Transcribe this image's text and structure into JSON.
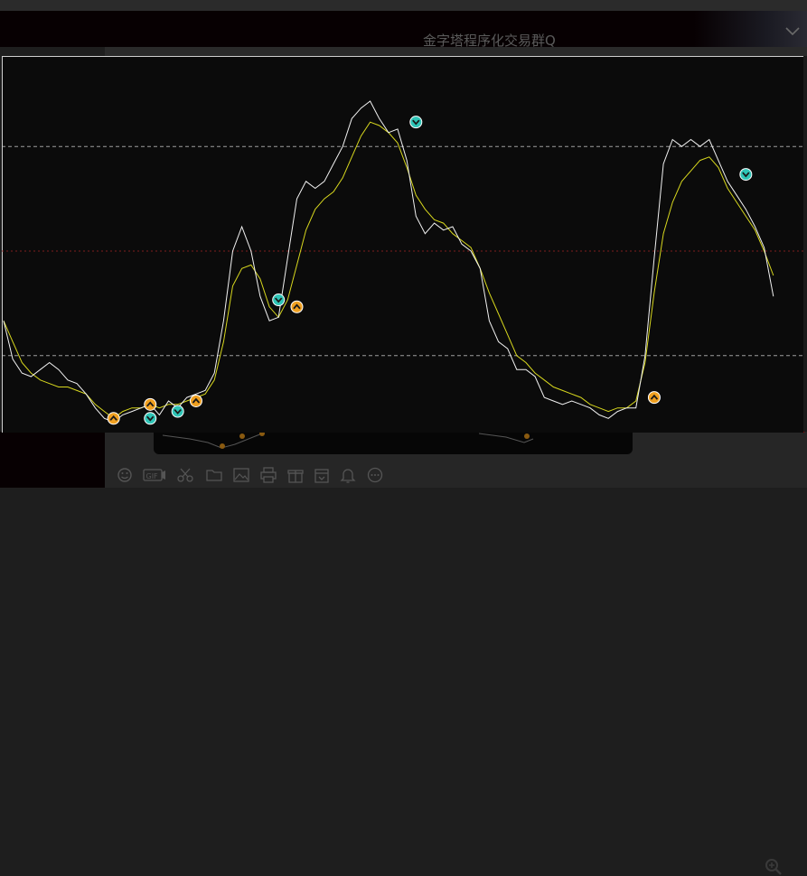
{
  "chat": {
    "title": "金字塔程序化交易群Q"
  },
  "colors": {
    "chart_background": "#0b0b0b",
    "price_line": "#f2f2f2",
    "signal_line": "#d8d81e",
    "sell_marker": "#2ec4b6",
    "buy_marker": "#f0a020",
    "level_line_white": "#cfcfcf",
    "level_line_red": "#8a2020"
  },
  "toolbar_icons": [
    "emoji-icon",
    "gif-icon",
    "scissors-icon",
    "folder-icon",
    "image-icon",
    "printer-icon",
    "gift-icon",
    "calendar-icon",
    "bell-icon",
    "more-icon"
  ],
  "chart_data": {
    "type": "line",
    "ylim": [
      0,
      100
    ],
    "levels": [
      {
        "value": 80,
        "style": "dashed-white"
      },
      {
        "value": 50,
        "style": "dotted-red"
      },
      {
        "value": 20,
        "style": "dashed-white"
      }
    ],
    "series": [
      {
        "values": [
          30,
          19,
          15,
          14,
          16,
          18,
          16,
          13,
          12,
          9,
          5,
          2,
          1,
          3,
          4,
          5,
          6,
          3,
          7,
          5,
          8,
          9,
          10,
          15,
          30,
          50,
          57,
          50,
          37,
          30,
          31,
          48,
          65,
          70,
          68,
          70,
          75,
          80,
          88,
          91,
          93,
          88,
          84,
          85,
          76,
          60,
          55,
          58,
          56,
          57,
          52,
          50,
          45,
          30,
          24,
          22,
          16,
          16,
          14,
          8,
          7,
          6,
          7,
          6,
          5,
          3,
          2,
          4,
          5,
          5,
          20,
          48,
          75,
          82,
          80,
          82,
          80,
          82,
          76,
          70,
          66,
          62,
          57,
          51,
          37
        ]
      },
      {
        "values": [
          30,
          24,
          18,
          15,
          13,
          12,
          11,
          11,
          10,
          9,
          6,
          4,
          2,
          4,
          5,
          5,
          6,
          5,
          6,
          6,
          7,
          8,
          9,
          13,
          24,
          40,
          45,
          46,
          42,
          34,
          31,
          36,
          46,
          56,
          62,
          65,
          67,
          71,
          77,
          83,
          87,
          86,
          84,
          81,
          74,
          66,
          62,
          59,
          58,
          55,
          53,
          51,
          45,
          38,
          32,
          26,
          20,
          18,
          15,
          13,
          11,
          10,
          9,
          8,
          6,
          5,
          4,
          5,
          5,
          7,
          18,
          38,
          55,
          64,
          70,
          73,
          76,
          77,
          74,
          68,
          64,
          60,
          56,
          50,
          43
        ]
      }
    ],
    "markers": [
      {
        "x": 12,
        "y": 2,
        "kind": "buy"
      },
      {
        "x": 16,
        "y": 2,
        "kind": "sell"
      },
      {
        "x": 16,
        "y": 6,
        "kind": "buy"
      },
      {
        "x": 19,
        "y": 4,
        "kind": "sell"
      },
      {
        "x": 21,
        "y": 7,
        "kind": "buy"
      },
      {
        "x": 30,
        "y": 36,
        "kind": "sell"
      },
      {
        "x": 32,
        "y": 34,
        "kind": "buy"
      },
      {
        "x": 45,
        "y": 87,
        "kind": "sell"
      },
      {
        "x": 71,
        "y": 8,
        "kind": "buy"
      },
      {
        "x": 81,
        "y": 72,
        "kind": "sell"
      }
    ]
  }
}
